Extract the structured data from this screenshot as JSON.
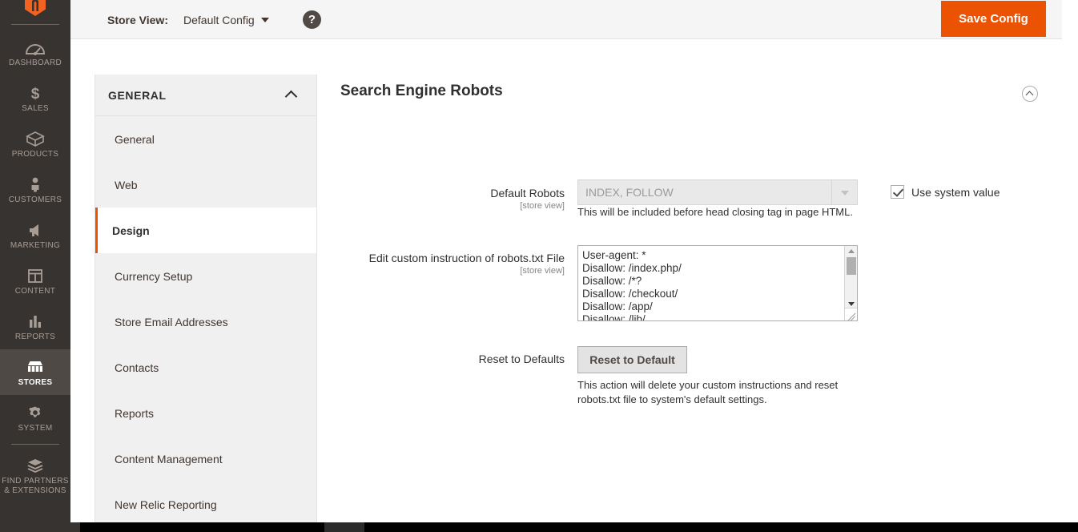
{
  "topbar": {
    "store_view_label": "Store View:",
    "store_view_value": "Default Config",
    "help_icon": "question-mark-icon",
    "save_label": "Save Config",
    "accent_color": "#eb5202"
  },
  "admin_sidebar": {
    "items": [
      {
        "label": "DASHBOARD",
        "icon": "dashboard-gauge-icon",
        "active": false
      },
      {
        "label": "SALES",
        "icon": "dollar-sign-icon",
        "active": false
      },
      {
        "label": "PRODUCTS",
        "icon": "box-icon",
        "active": false
      },
      {
        "label": "CUSTOMERS",
        "icon": "person-icon",
        "active": false
      },
      {
        "label": "MARKETING",
        "icon": "megaphone-icon",
        "active": false
      },
      {
        "label": "CONTENT",
        "icon": "layout-panels-icon",
        "active": false
      },
      {
        "label": "REPORTS",
        "icon": "bar-chart-icon",
        "active": false
      },
      {
        "label": "STORES",
        "icon": "storefront-icon",
        "active": true
      },
      {
        "label": "SYSTEM",
        "icon": "gear-icon",
        "active": false
      }
    ],
    "partners_line1": "FIND PARTNERS",
    "partners_line2": "& EXTENSIONS",
    "partners_icon": "stacked-blocks-icon",
    "background_color": "#373330",
    "active_background_color": "#4f4945"
  },
  "config_nav": {
    "section_title": "GENERAL",
    "collapse_icon": "chevron-up-icon",
    "items": [
      {
        "label": "General",
        "active": false
      },
      {
        "label": "Web",
        "active": false
      },
      {
        "label": "Design",
        "active": true
      },
      {
        "label": "Currency Setup",
        "active": false
      },
      {
        "label": "Store Email Addresses",
        "active": false
      },
      {
        "label": "Contacts",
        "active": false
      },
      {
        "label": "Reports",
        "active": false
      },
      {
        "label": "Content Management",
        "active": false
      },
      {
        "label": "New Relic Reporting",
        "active": false
      }
    ],
    "active_marker_color": "#eb5202"
  },
  "main": {
    "section_heading": "Search Engine Robots",
    "section_collapse_icon": "circle-chevron-up-icon",
    "default_robots": {
      "label": "Default Robots",
      "scope": "[store view]",
      "value": "INDEX, FOLLOW",
      "disabled": true,
      "note": "This will be included before head closing tag in page HTML.",
      "use_system_value_label": "Use system value",
      "use_system_value_checked": true
    },
    "robots_txt": {
      "label": "Edit custom instruction of robots.txt File",
      "scope": "[store view]",
      "value": "User-agent: *\nDisallow: /index.php/\nDisallow: /*?\nDisallow: /checkout/\nDisallow: /app/\nDisallow: /lib/"
    },
    "reset": {
      "label": "Reset to Defaults",
      "scope": "",
      "button_label": "Reset to Default",
      "note": "This action will delete your custom instructions and reset robots.txt file to system's default settings."
    }
  }
}
